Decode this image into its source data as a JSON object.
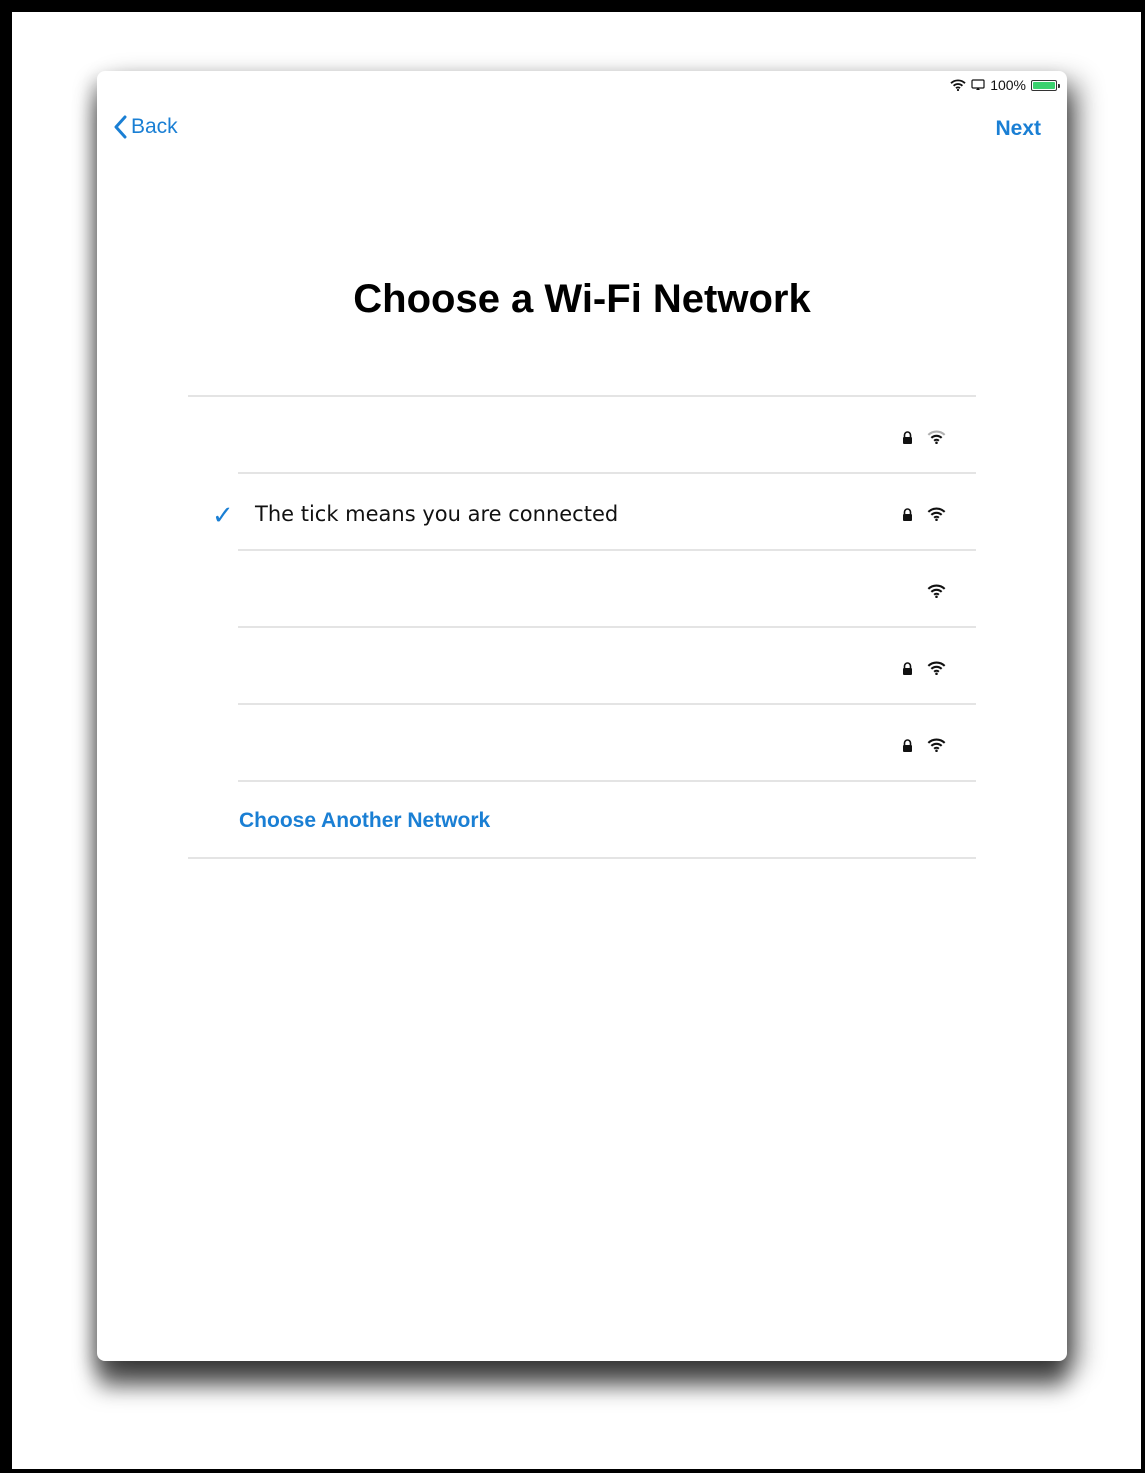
{
  "status_bar": {
    "battery_text": "100%",
    "icons": [
      "wifi-icon",
      "screen-mirror-icon",
      "battery-charging-icon"
    ]
  },
  "nav": {
    "back_label": "Back",
    "next_label": "Next"
  },
  "title": "Choose a Wi-Fi Network",
  "networks": [
    {
      "label": "",
      "locked": true,
      "connected": false
    },
    {
      "label": "The tick means you are connected",
      "locked": true,
      "connected": true
    },
    {
      "label": "",
      "locked": false,
      "connected": false
    },
    {
      "label": "",
      "locked": true,
      "connected": false
    },
    {
      "label": "",
      "locked": true,
      "connected": false
    }
  ],
  "other_network_label": "Choose Another Network",
  "colors": {
    "accent": "#1a7fd4",
    "battery": "#3bd16f"
  }
}
